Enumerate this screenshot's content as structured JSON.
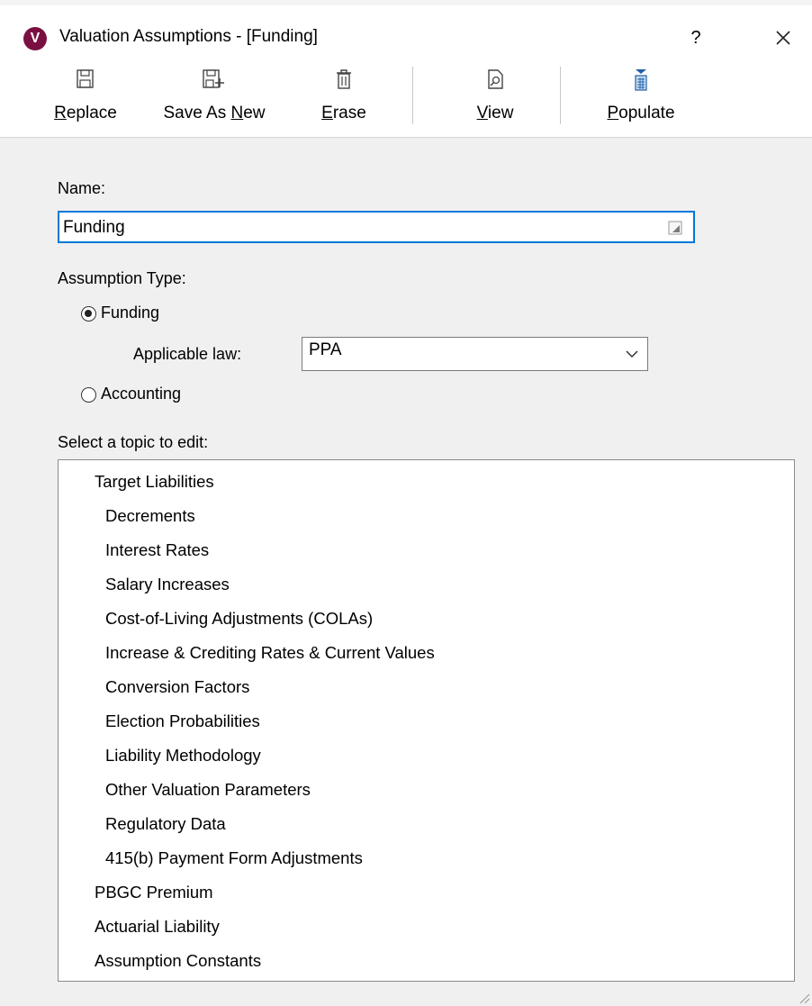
{
  "window": {
    "title": "Valuation Assumptions - [Funding]",
    "logo_letter": "V",
    "help_label": "?",
    "accent_color": "#0078d7",
    "logo_color": "#7a1042"
  },
  "toolbar": {
    "replace": {
      "prefix": "",
      "key": "R",
      "rest": "eplace",
      "icon": "save-icon"
    },
    "save_as_new": {
      "prefix": "Save As ",
      "key": "N",
      "rest": "ew",
      "icon": "save-as-new-icon"
    },
    "erase": {
      "prefix": "",
      "key": "E",
      "rest": "rase",
      "icon": "trash-icon"
    },
    "view": {
      "prefix": "",
      "key": "V",
      "rest": "iew",
      "icon": "view-document-icon"
    },
    "populate": {
      "prefix": "",
      "key": "P",
      "rest": "opulate",
      "icon": "populate-icon"
    }
  },
  "form": {
    "name_label": "Name:",
    "name_value": "Funding",
    "assumption_type_label": "Assumption Type:",
    "funding_option": "Funding",
    "funding_selected": true,
    "applicable_law_label": "Applicable law:",
    "applicable_law_value": "PPA",
    "accounting_option": "Accounting",
    "accounting_selected": false,
    "topic_label": "Select a topic to edit:"
  },
  "topics": [
    {
      "label": "Target Liabilities",
      "level": 0
    },
    {
      "label": "Decrements",
      "level": 1
    },
    {
      "label": "Interest Rates",
      "level": 1
    },
    {
      "label": "Salary Increases",
      "level": 1
    },
    {
      "label": "Cost-of-Living Adjustments (COLAs)",
      "level": 1
    },
    {
      "label": "Increase & Crediting Rates & Current Values",
      "level": 1
    },
    {
      "label": "Conversion Factors",
      "level": 1
    },
    {
      "label": "Election Probabilities",
      "level": 1
    },
    {
      "label": "Liability Methodology",
      "level": 1
    },
    {
      "label": "Other Valuation Parameters",
      "level": 1
    },
    {
      "label": "Regulatory Data",
      "level": 1
    },
    {
      "label": "415(b) Payment Form Adjustments",
      "level": 1
    },
    {
      "label": "PBGC Premium",
      "level": 0
    },
    {
      "label": "Actuarial Liability",
      "level": 0
    },
    {
      "label": "Assumption Constants",
      "level": 0
    }
  ]
}
